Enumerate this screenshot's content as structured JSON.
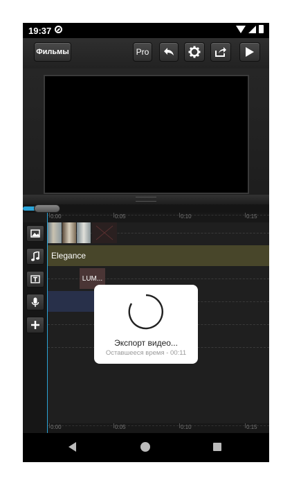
{
  "status_bar": {
    "time": "19:37"
  },
  "toolbar": {
    "films_label": "Фильмы",
    "pro_label": "Pro"
  },
  "timeline": {
    "ruler_labels": [
      "0:00",
      "0:05",
      "0:10",
      "0:15"
    ],
    "music_clip_label": "Elegance",
    "title_clip_label": "LUM..."
  },
  "export_dialog": {
    "title": "Экспорт видео...",
    "remaining": "Оставшееся время - 00:11"
  },
  "colors": {
    "accent": "#2aa4d8",
    "music_track": "#48462a",
    "title_clip": "#4a3535",
    "voice_track": "#28304a"
  }
}
